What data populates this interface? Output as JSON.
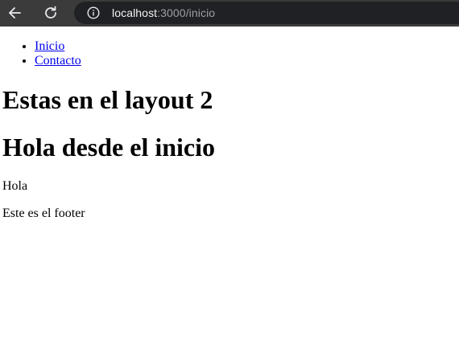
{
  "browser": {
    "url_host": "localhost",
    "url_rest": ":3000/inicio"
  },
  "nav": {
    "items": [
      {
        "label": "Inicio"
      },
      {
        "label": "Contacto"
      }
    ]
  },
  "layout_heading": "Estas en el layout 2",
  "page_heading": "Hola desde el inicio",
  "body_text": "Hola",
  "footer_text": "Este es el footer"
}
